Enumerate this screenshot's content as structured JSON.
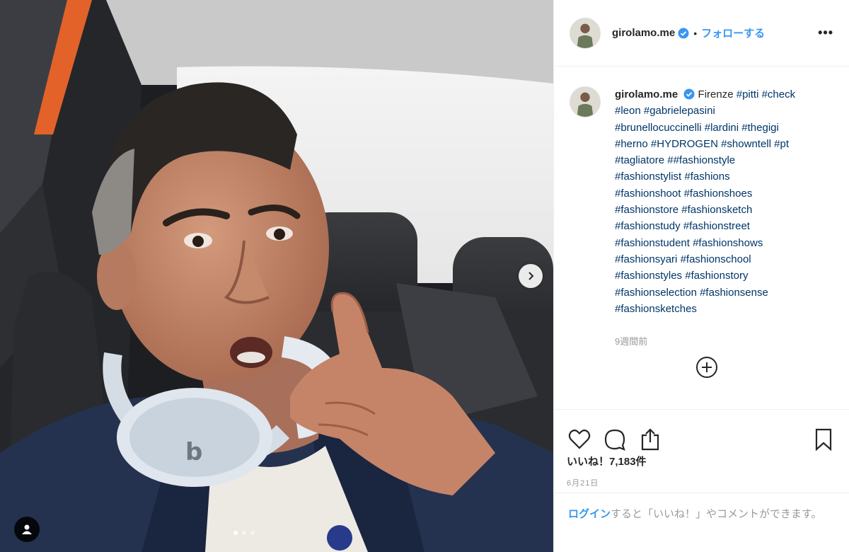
{
  "post": {
    "username": "girolamo.me",
    "follow_label": "フォローする",
    "separator": "•",
    "more_label": "•••"
  },
  "caption": {
    "username": "girolamo.me",
    "lines": [
      "Firenze #pitti #check",
      "#leon #gabrielepasini",
      "#brunellocuccinelli #lardini #thegigi",
      "#herno #HYDROGEN #showntell #pt",
      "#tagliatore ##fashionstyle",
      "#fashionstylist #fashions",
      "#fashionshoot #fashionshoes",
      "#fashionstore #fashionsketch",
      "#fashionstudy #fashionstreet",
      "#fashionstudent #fashionshows",
      "#fashionsyari #fashionschool",
      "#fashionstyles #fashionstory",
      "#fashionselection #fashionsense",
      "#fashionsketches"
    ],
    "time_ago": "9週間前"
  },
  "engagement": {
    "likes_label": "いいね！7,183件",
    "date": "6月21日"
  },
  "login_prompt": {
    "link": "ログイン",
    "text": "すると「いいね！」やコメントができます。"
  },
  "icons": {
    "verified": "verified-badge-icon",
    "heart": "heart-icon",
    "comment": "comment-icon",
    "share": "share-icon",
    "save": "bookmark-icon",
    "plus": "plus-circle-icon",
    "next": "chevron-right-icon",
    "tag": "user-tag-icon"
  },
  "colors": {
    "link_blue": "#3897f0",
    "hashtag": "#003569",
    "muted": "#999999",
    "text": "#262626"
  }
}
